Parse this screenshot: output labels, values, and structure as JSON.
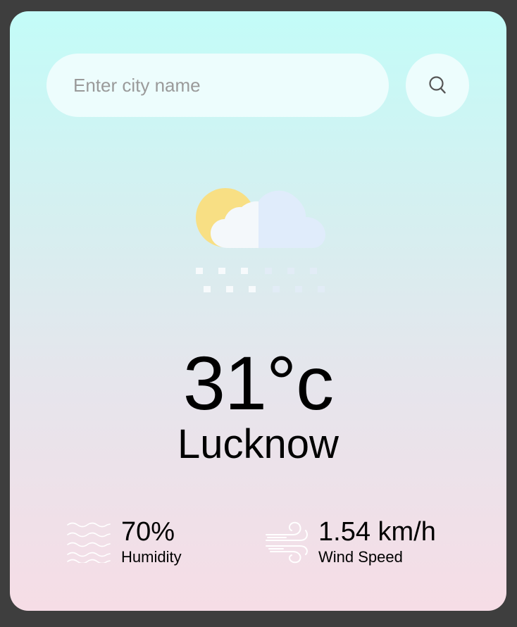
{
  "search": {
    "placeholder": "Enter city name",
    "value": "",
    "button_icon": "search-icon"
  },
  "weather": {
    "icon": "partly-cloudy-rain-icon",
    "temperature": "31°c",
    "city": "Lucknow"
  },
  "stats": {
    "humidity": {
      "icon": "humidity-waves-icon",
      "value": "70%",
      "label": "Humidity"
    },
    "wind": {
      "icon": "wind-icon",
      "value": "1.54 km/h",
      "label": "Wind Speed"
    }
  },
  "colors": {
    "gradient_top": "#c3fcf8",
    "gradient_bottom": "#f6dde6",
    "sun": "#f8df84",
    "cloud_light": "#f4f8fb",
    "cloud_blue": "#e0ecfb"
  }
}
